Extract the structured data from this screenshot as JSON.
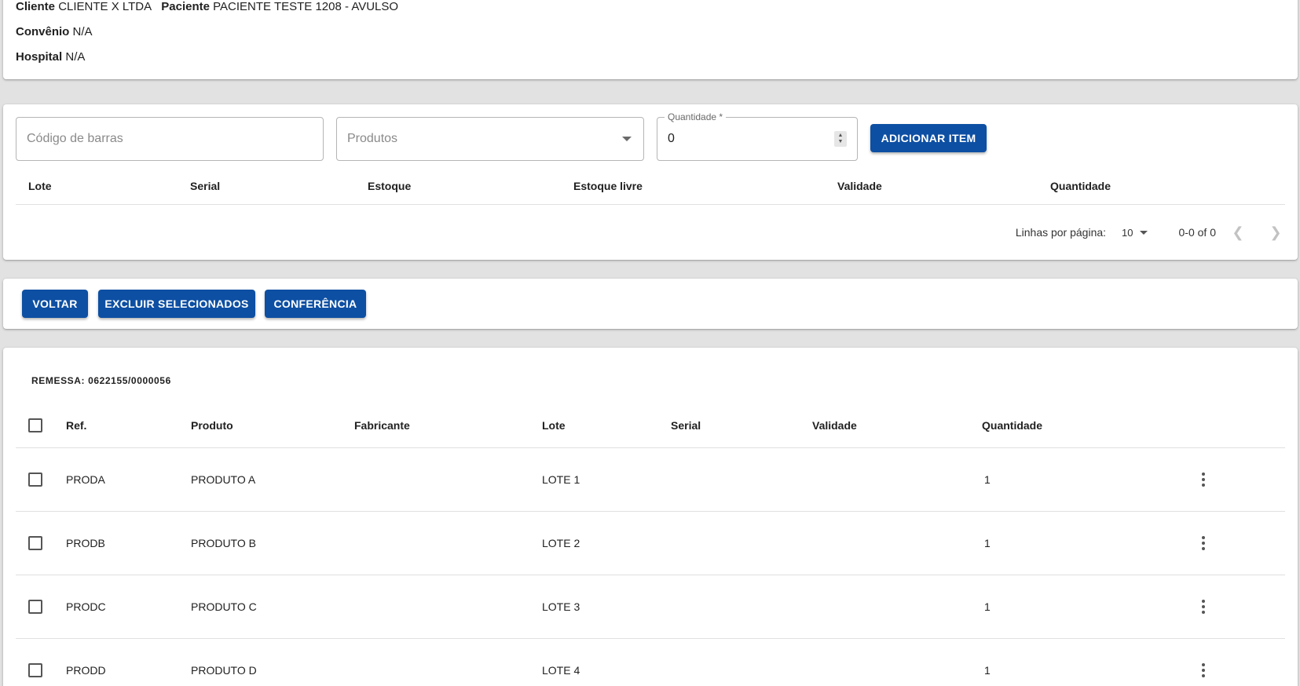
{
  "info": {
    "cliente_label": "Cliente",
    "cliente_value": "CLIENTE X LTDA",
    "paciente_label": "Paciente",
    "paciente_value": "PACIENTE TESTE 1208 - AVULSO",
    "convenio_label": "Convênio",
    "convenio_value": "N/A",
    "hospital_label": "Hospital",
    "hospital_value": "N/A"
  },
  "add_item": {
    "barcode_placeholder": "Código de barras",
    "products_placeholder": "Produtos",
    "quantity_label": "Quantidade *",
    "quantity_value": "0",
    "add_button": "ADICIONAR ITEM",
    "columns": [
      "Lote",
      "Serial",
      "Estoque",
      "Estoque livre",
      "Validade",
      "Quantidade"
    ],
    "pagination": {
      "rows_per_page_label": "Linhas por página:",
      "rows_per_page_value": "10",
      "range": "0-0 of 0"
    }
  },
  "actions": {
    "back": "VOLTAR",
    "delete_selected": "EXCLUIR SELECIONADOS",
    "check": "CONFERÊNCIA"
  },
  "shipment": {
    "title": "REMESSA: 0622155/0000056",
    "columns": [
      "Ref.",
      "Produto",
      "Fabricante",
      "Lote",
      "Serial",
      "Validade",
      "Quantidade"
    ],
    "rows": [
      {
        "ref": "PRODA",
        "produto": "PRODUTO A",
        "fabricante": "",
        "lote": "LOTE 1",
        "serial": "",
        "validade": "",
        "quantidade": "1"
      },
      {
        "ref": "PRODB",
        "produto": "PRODUTO B",
        "fabricante": "",
        "lote": "LOTE 2",
        "serial": "",
        "validade": "",
        "quantidade": "1"
      },
      {
        "ref": "PRODC",
        "produto": "PRODUTO C",
        "fabricante": "",
        "lote": "LOTE 3",
        "serial": "",
        "validade": "",
        "quantidade": "1"
      },
      {
        "ref": "PRODD",
        "produto": "PRODUTO D",
        "fabricante": "",
        "lote": "LOTE 4",
        "serial": "",
        "validade": "",
        "quantidade": "1"
      }
    ]
  },
  "colors": {
    "primary": "#0d4fa3",
    "background": "#e2e2e2"
  }
}
